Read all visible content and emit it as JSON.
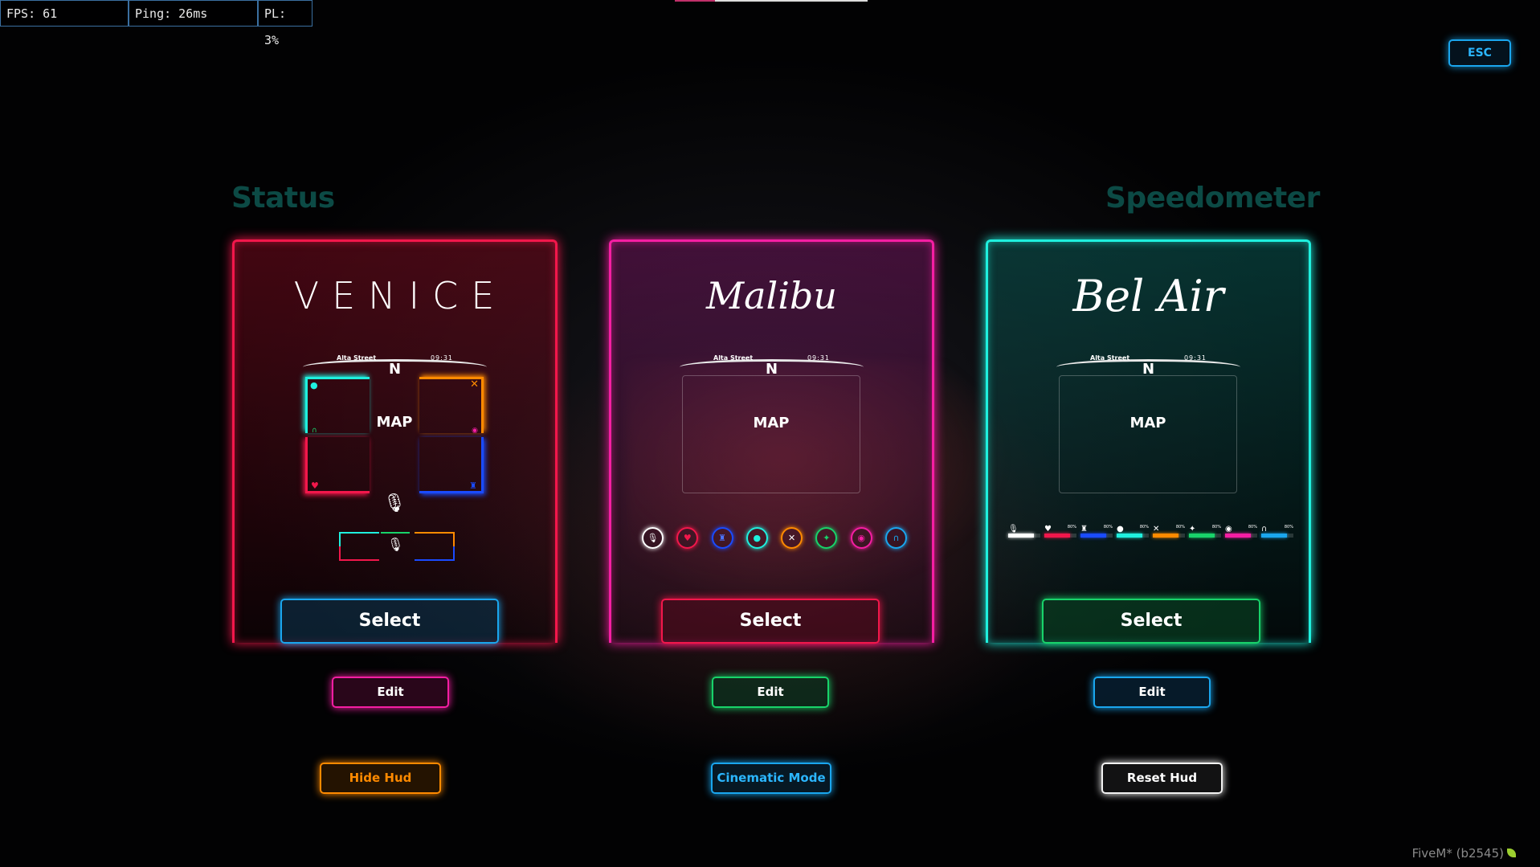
{
  "perf": {
    "fps": "FPS: 61",
    "ping": "Ping: 26ms",
    "pl": "PL: 3%"
  },
  "esc_label": "ESC",
  "headings": {
    "status": "Status",
    "speedometer": "Speedometer"
  },
  "cards": [
    {
      "title": "VENICE",
      "street": "Alta Street",
      "time": "09:31",
      "north": "N",
      "map": "MAP",
      "select_label": "Select",
      "edit_label": "Edit",
      "accent": "#f2174b"
    },
    {
      "title": "Malibu",
      "street": "Alta Street",
      "time": "09:31",
      "north": "N",
      "map": "MAP",
      "select_label": "Select",
      "edit_label": "Edit",
      "accent": "#f51ea3",
      "status_icons": [
        {
          "icon": "microphone-icon",
          "color": "#ffffff"
        },
        {
          "icon": "heart-icon",
          "color": "#f2174b"
        },
        {
          "icon": "armor-icon",
          "color": "#1a4bff"
        },
        {
          "icon": "water-drop-icon",
          "color": "#1ff0de"
        },
        {
          "icon": "food-icon",
          "color": "#ff8a00"
        },
        {
          "icon": "stamina-icon",
          "color": "#18d36a"
        },
        {
          "icon": "stress-icon",
          "color": "#f51ea3"
        },
        {
          "icon": "oxygen-icon",
          "color": "#1aa6ee"
        }
      ]
    },
    {
      "title": "Bel Air",
      "street": "Alta Street",
      "time": "09:31",
      "north": "N",
      "map": "MAP",
      "select_label": "Select",
      "edit_label": "Edit",
      "accent": "#1ff0de",
      "status_bars": [
        {
          "icon": "microphone-icon",
          "pct": "",
          "level": 0.8,
          "color": "#ffffff"
        },
        {
          "icon": "heart-icon",
          "pct": "80%",
          "level": 0.8,
          "color": "#f2174b"
        },
        {
          "icon": "armor-icon",
          "pct": "80%",
          "level": 0.8,
          "color": "#1a4bff"
        },
        {
          "icon": "water-drop-icon",
          "pct": "80%",
          "level": 0.8,
          "color": "#1ff0de"
        },
        {
          "icon": "food-icon",
          "pct": "80%",
          "level": 0.8,
          "color": "#ff8a00"
        },
        {
          "icon": "stamina-icon",
          "pct": "80%",
          "level": 0.8,
          "color": "#18d36a"
        },
        {
          "icon": "stress-icon",
          "pct": "80%",
          "level": 0.8,
          "color": "#f51ea3"
        },
        {
          "icon": "oxygen-icon",
          "pct": "80%",
          "level": 0.8,
          "color": "#1aa6ee"
        }
      ]
    }
  ],
  "actions": {
    "hide": "Hide Hud",
    "cinematic": "Cinematic Mode",
    "reset": "Reset Hud"
  },
  "watermark": "FiveM* (b2545)"
}
